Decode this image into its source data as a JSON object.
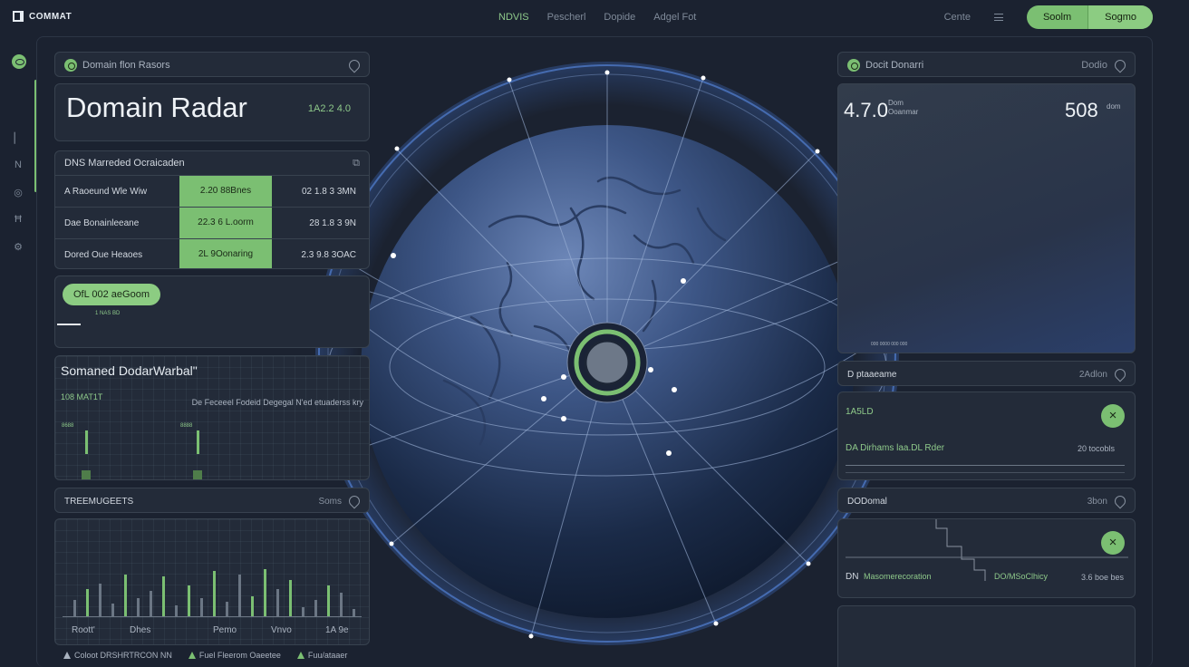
{
  "topbar": {
    "logo": "COMMAT",
    "nav": [
      "NDVIS",
      "Pescherl",
      "Dopide",
      "Adgel Fot"
    ],
    "link": "Cente",
    "buttons": [
      "Soolm",
      "Sogmo"
    ]
  },
  "sidebar": {
    "icons": [
      "logo-icon",
      "line-icon",
      "n-icon",
      "shield-icon",
      "h-icon",
      "gear-icon"
    ],
    "glyphs": [
      "⊡",
      "Ν",
      "◎",
      "Ħ",
      "⚙"
    ]
  },
  "left": {
    "header": "Domain flon Rasors",
    "title": "Domain Radar",
    "title_value": "1A2.2 4.0",
    "dns": {
      "header": "DNS Marreded Ocraicaden",
      "rows": [
        {
          "name": "A Raoeund Wle Wiw",
          "value": "2.20 88Bnes",
          "right": "02 1.8 3 3MN"
        },
        {
          "name": "Dae Bonainleeane",
          "value": "22.3 6 L.oorm",
          "right": "28 1.8 3 9N"
        },
        {
          "name": "Dored Oue Heaoes",
          "value": "2L 9Oonaring",
          "right": "2.3 9.8 3OAC"
        }
      ]
    },
    "pill": "OfL 002 aeGoom",
    "pill_sub": "1 NAS BD",
    "mini": {
      "title": "Somaned DodarWarbal\"",
      "left": "108 MAT1T",
      "right": "De Feceeel Fodeid Degegal N'ed etuaderss kry",
      "micro": [
        "8688",
        "8888"
      ]
    },
    "trends": {
      "header": "TREEMUGEETS",
      "header_right": "Soms",
      "labels": [
        "Roott'",
        "Dhes",
        "Pemo",
        "Vnvo",
        "1A 9e"
      ]
    },
    "legend": [
      "Coloot DRSHRTRCON NN",
      "Fuel Fleerom Oaeetee",
      "Fuu/ataaer"
    ]
  },
  "right": {
    "header": "Docit Donarri",
    "header_right": "Dodio",
    "stat1": "4.7.0",
    "stat1_sub": [
      "Dom",
      "Ooanmar"
    ],
    "stat2": "508",
    "stat2_sub": "dom",
    "stat_tiny": "000 0000 000 000",
    "sub_header": "D ptaaeame",
    "sub_header_right": "2Adlon",
    "status1": {
      "value": "1A5LD",
      "label": "DA Dirhams laa.DL Rder",
      "right": "20 tocobls"
    },
    "sub_header2": "DODomal",
    "sub_header2_right": "3bon",
    "status2": {
      "label1": "DN",
      "label2": "Masomerecoration",
      "label3": "DO/MSoClhicy",
      "right": "3.6 boe bes"
    }
  },
  "colors": {
    "accent": "#7bbf72",
    "background": "#1b2230",
    "panel": "#232b39",
    "border": "#38424f"
  }
}
